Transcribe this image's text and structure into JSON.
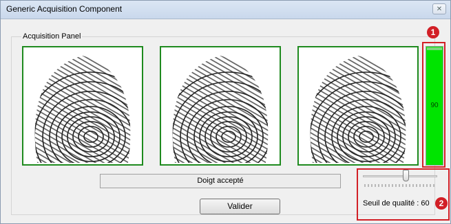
{
  "window": {
    "title": "Generic Acquisition Component",
    "close_glyph": "✕"
  },
  "panel": {
    "label": "Acquisition Panel"
  },
  "fingerprints": [
    {
      "icon": "fingerprint-icon"
    },
    {
      "icon": "fingerprint-icon"
    },
    {
      "icon": "fingerprint-icon"
    }
  ],
  "quality_meter": {
    "value_text": "90",
    "level": 0.9,
    "color": "#00e400"
  },
  "status_text": "Doigt accepté",
  "validate_label": "Valider",
  "threshold": {
    "label": "Seuil de qualité : 60",
    "level": 0.6
  },
  "callouts": {
    "one": "1",
    "two": "2",
    "color": "#d21f26"
  }
}
